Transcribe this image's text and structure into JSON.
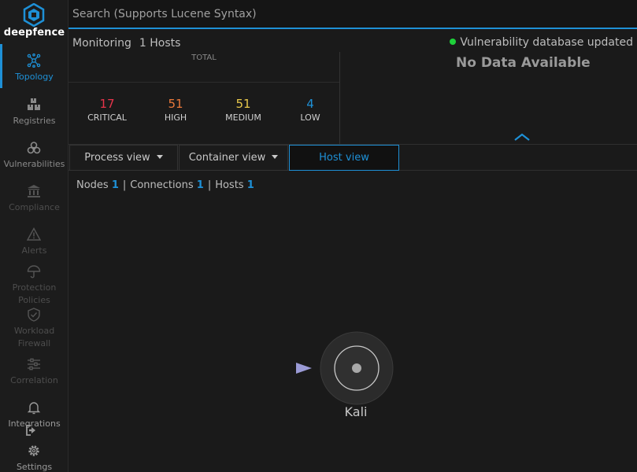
{
  "brand": {
    "name": "deepfence"
  },
  "sidebar": {
    "items": [
      {
        "label": "Topology",
        "icon": "topology-icon",
        "state": "active"
      },
      {
        "label": "Registries",
        "icon": "registries-icon",
        "state": "normal"
      },
      {
        "label": "Vulnerabilities",
        "icon": "biohazard-icon",
        "state": "normal"
      },
      {
        "label": "Compliance",
        "icon": "bank-icon",
        "state": "dim"
      },
      {
        "label": "Alerts",
        "icon": "warning-icon",
        "state": "dim"
      },
      {
        "label": "Protection Policies",
        "icon": "umbrella-icon",
        "state": "dim"
      },
      {
        "label": "Workload Firewall",
        "icon": "shield-icon",
        "state": "dim"
      },
      {
        "label": "Correlation",
        "icon": "sliders-icon",
        "state": "dim"
      },
      {
        "label": "Integrations",
        "icon": "bell-icon",
        "state": "normal"
      },
      {
        "label": "Settings",
        "icon": "gear-icon",
        "state": "normal"
      }
    ]
  },
  "search": {
    "placeholder": "Search (Supports Lucene Syntax)"
  },
  "monitoring": {
    "label": "Monitoring",
    "hosts": "1 Hosts"
  },
  "vuln_db": {
    "status": "Vulnerability database updated",
    "status_color": "#1ed13a"
  },
  "no_data": "No Data Available",
  "severity": {
    "total_label": "TOTAL",
    "items": [
      {
        "value": "17",
        "label": "CRITICAL",
        "color": "#e6344a"
      },
      {
        "value": "51",
        "label": "HIGH",
        "color": "#e9783a"
      },
      {
        "value": "51",
        "label": "MEDIUM",
        "color": "#e8c84b"
      },
      {
        "value": "4",
        "label": "LOW",
        "color": "#1e90d6"
      }
    ]
  },
  "views": {
    "process": "Process view",
    "container": "Container view",
    "host": "Host view",
    "active": "host"
  },
  "stats": {
    "nodes_label": "Nodes",
    "nodes": "1",
    "connections_label": "Connections",
    "connections": "1",
    "hosts_label": "Hosts",
    "hosts": "1"
  },
  "graph": {
    "node_label": "Kali",
    "accent": "#1e90d6"
  }
}
